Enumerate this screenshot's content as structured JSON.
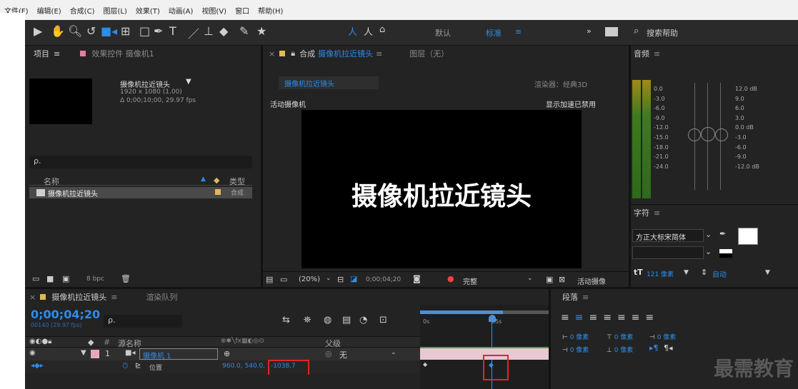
{
  "menu": [
    "文件(F)",
    "编辑(E)",
    "合成(C)",
    "图层(L)",
    "效果(T)",
    "动画(A)",
    "视图(V)",
    "窗口",
    "帮助(H)"
  ],
  "toolbar": {
    "workspace_default": "默认",
    "workspace_standard": "标准",
    "expand": "»",
    "search_placeholder": "搜索帮助"
  },
  "project": {
    "tab": "项目",
    "effects_tab": "效果控件 摄像机1",
    "comp_name": "摄像机拉近镜头",
    "comp_size": "1920 x 1080 (1.00)",
    "comp_duration": "Δ 0;00;10;00, 29.97 fps",
    "col_name": "名称",
    "col_type": "类型",
    "item_name": "摄像机拉近镜头",
    "item_type": "合成",
    "bpc": "8 bpc"
  },
  "composition": {
    "tab_prefix": "合成",
    "tab_name": "摄像机拉近镜头",
    "layer_tab": "图层（无）",
    "subtab": "摄像机拉近镜头",
    "renderer": "渲染器：经典3D",
    "active_camera": "活动摄像机",
    "gpu_note": "显示加速已禁用",
    "canvas_text": "摄像机拉近镜头",
    "zoom": "(20%)",
    "timecode": "0;00;04;20",
    "quality": "完整",
    "view": "活动摄像"
  },
  "audio": {
    "tab": "音频",
    "levels": [
      "0.0",
      "-3.0",
      "-6.0",
      "-9.0",
      "-12.0",
      "-15.0",
      "-18.0",
      "-21.0",
      "-24.0"
    ],
    "db": [
      "12.0 dB",
      "9.0",
      "6.0",
      "3.0",
      "0.0 dB",
      "-3.0",
      "-6.0",
      "-9.0",
      "-12.0 dB"
    ]
  },
  "character": {
    "tab": "字符",
    "font": "方正大标宋简体",
    "size": "121 像素",
    "leading": "自动"
  },
  "paragraph": {
    "tab": "段落",
    "indent": "0 像素"
  },
  "timeline": {
    "tab": "摄像机拉近镜头",
    "render_queue": "渲染队列",
    "timecode": "0;00;04;20",
    "frames": "00140 (29.97 fps)",
    "col_source": "源名称",
    "col_parent": "父级",
    "layer_num": "1",
    "layer_name": "摄像机 1",
    "parent_value": "无",
    "prop_name": "位置",
    "prop_value_xy": "960.0, 540.0,",
    "prop_value_z": "-1038.7",
    "ruler_start": "0s",
    "ruler_mark": "05s"
  },
  "watermark": "最需教育"
}
